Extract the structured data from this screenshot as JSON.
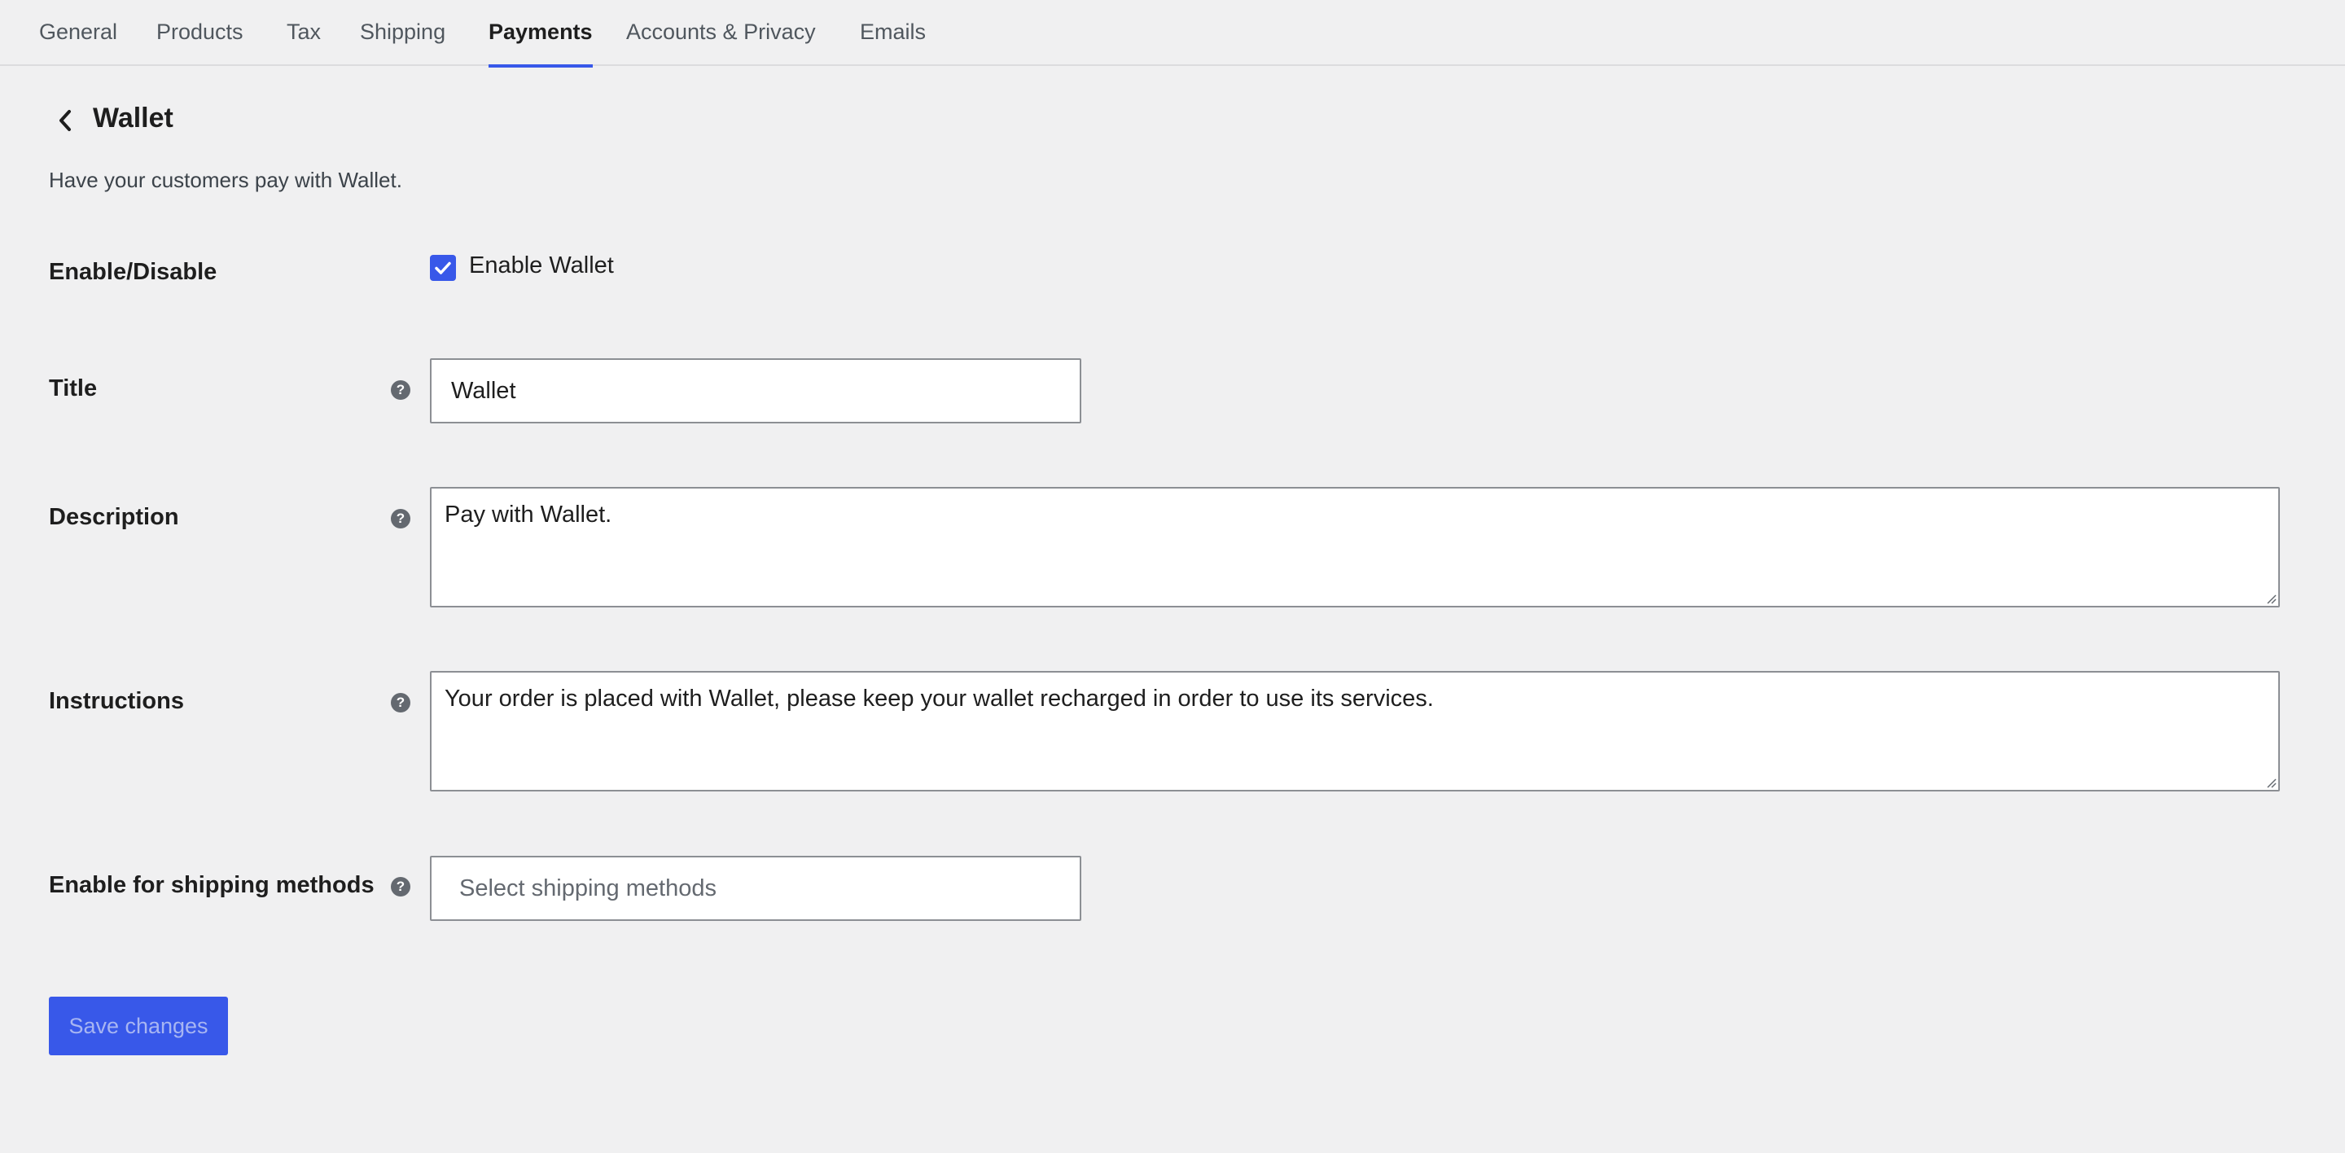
{
  "tabs": [
    {
      "label": "General"
    },
    {
      "label": "Products"
    },
    {
      "label": "Tax"
    },
    {
      "label": "Shipping"
    },
    {
      "label": "Payments"
    },
    {
      "label": "Accounts & Privacy"
    },
    {
      "label": "Emails"
    }
  ],
  "active_tab": "Payments",
  "header": {
    "back_icon": "chevron-left-icon",
    "title": "Wallet",
    "description": "Have your customers pay with Wallet."
  },
  "form": {
    "enable": {
      "label": "Enable/Disable",
      "checkbox_label": "Enable Wallet",
      "checked": true
    },
    "title": {
      "label": "Title",
      "value": "Wallet"
    },
    "description": {
      "label": "Description",
      "value": "Pay with Wallet."
    },
    "instructions": {
      "label": "Instructions",
      "value": "Your order is placed with Wallet, please keep your wallet recharged in order to use its services."
    },
    "shipping_methods": {
      "label": "Enable for shipping methods",
      "placeholder": "Select shipping methods"
    },
    "help_glyph": "?"
  },
  "footer": {
    "save_label": "Save changes"
  },
  "colors": {
    "accent": "#3858e9",
    "background": "#f0f0f1"
  }
}
